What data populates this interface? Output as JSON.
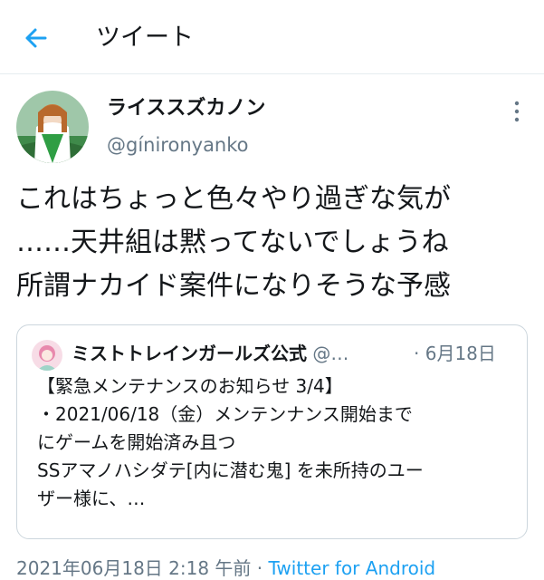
{
  "header": {
    "title": "ツイート"
  },
  "author": {
    "display_name": "ライススズカノン",
    "handle": "@gínironyanko"
  },
  "tweet": {
    "lines": [
      "これはちょっと色々やり過ぎな気が",
      "……天井組は黙ってないでしょうね",
      "所謂ナカイド案件になりそうな予感"
    ]
  },
  "quote": {
    "name": "ミストトレインガールズ公式",
    "handle": "@…",
    "separator": "·",
    "date": "6月18日",
    "lines": [
      "【緊急メンテナンスのお知らせ 3/4】",
      "・2021/06/18（金）メンテンナンス開始まで",
      "にゲームを開始済み且つ",
      "SSアマノハシダテ[内に潜む鬼] を未所持のユー",
      "ザー様に、…"
    ]
  },
  "meta": {
    "timestamp": "2021年06月18日 2:18 午前",
    "separator": "·",
    "source": "Twitter for Android"
  },
  "colors": {
    "accent": "#1da1f2",
    "secondary_text": "#657786",
    "border": "#e6ecf0"
  }
}
